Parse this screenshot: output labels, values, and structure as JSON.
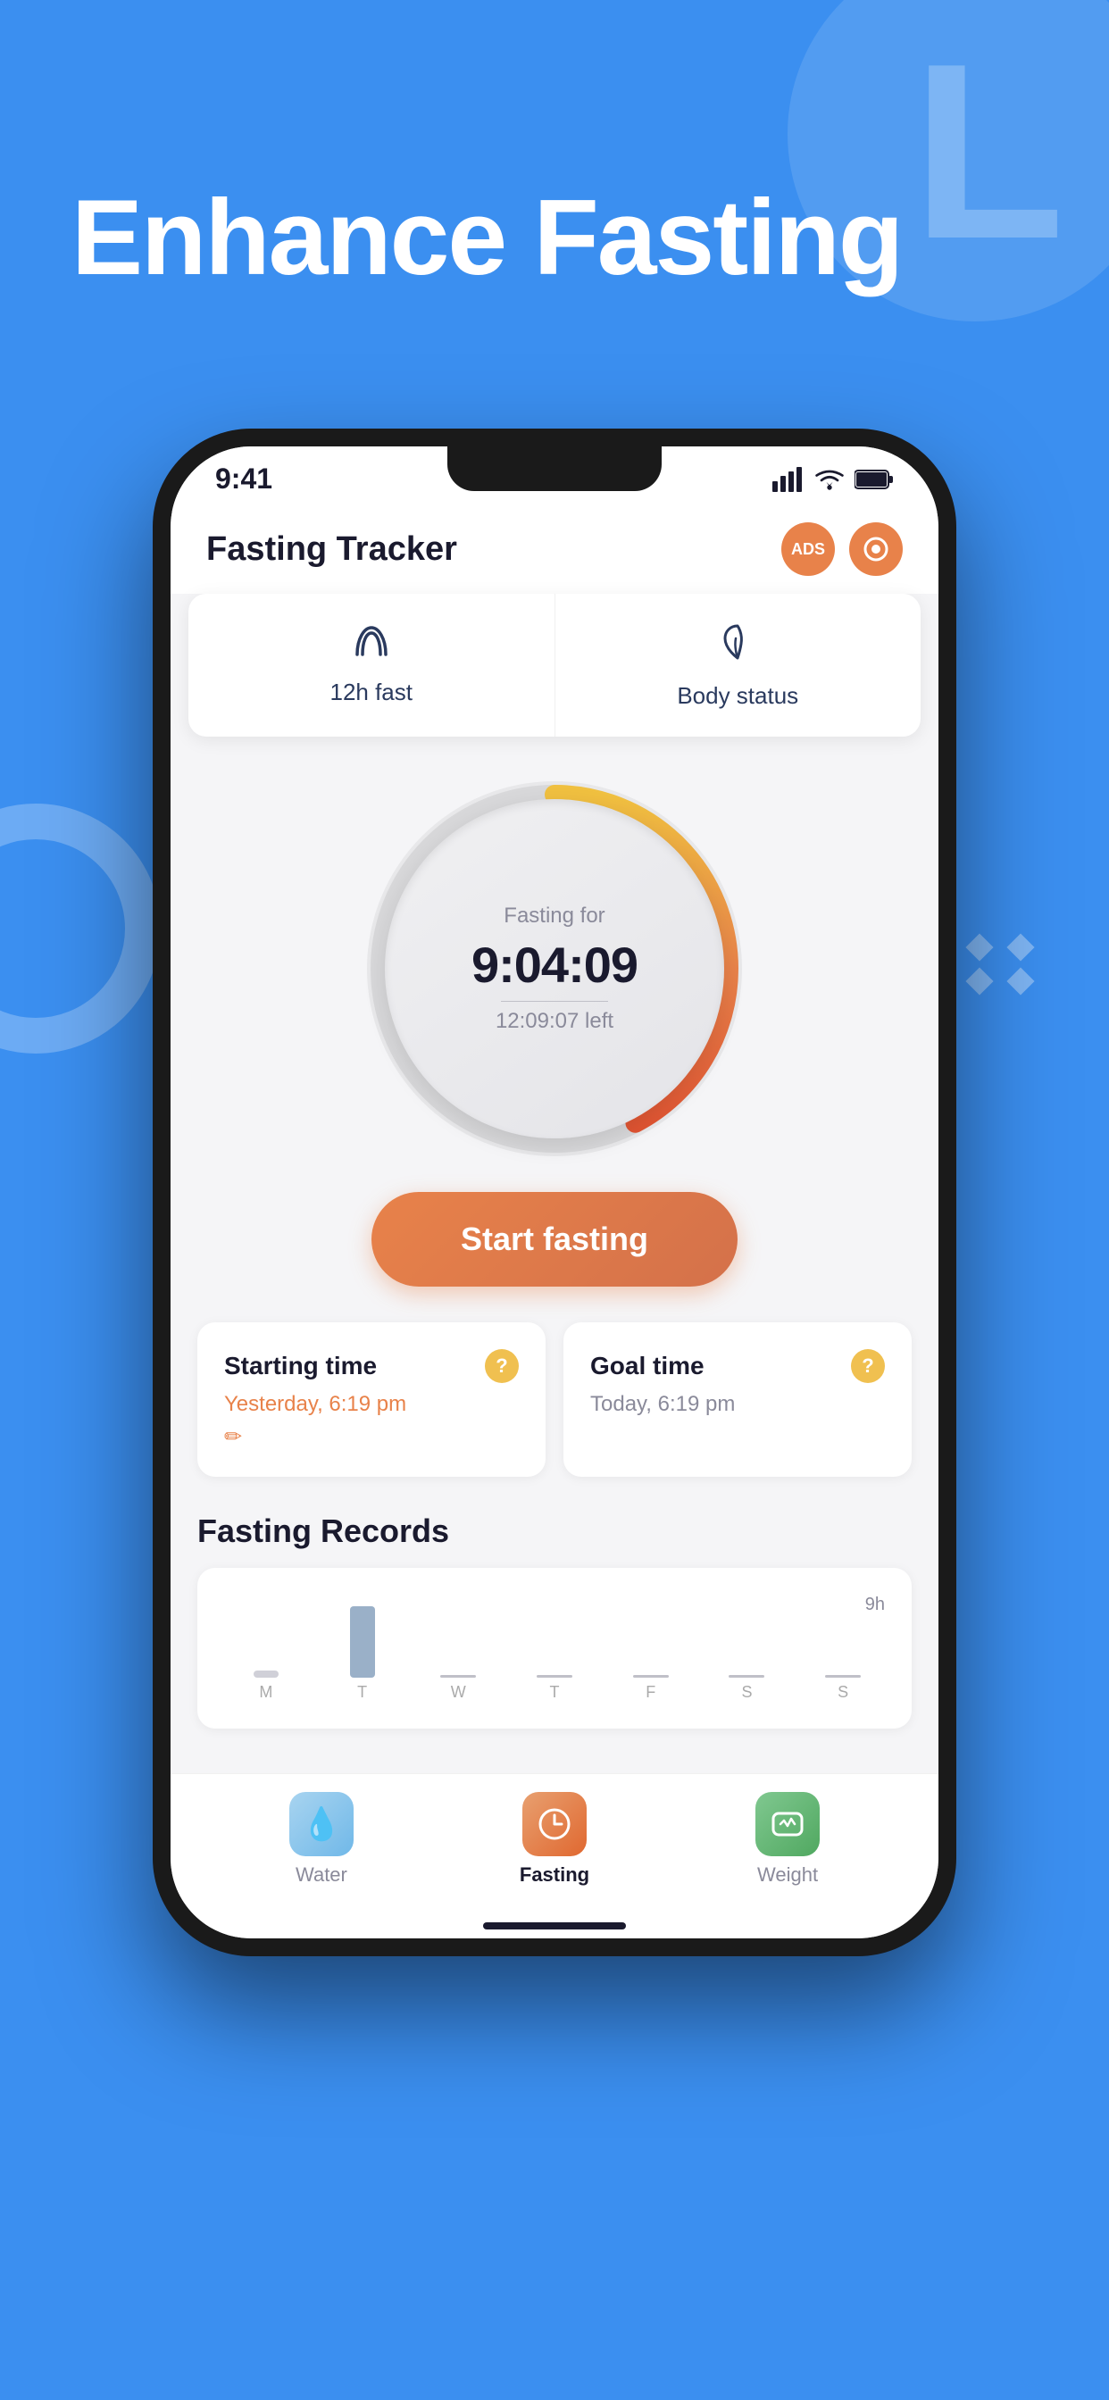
{
  "page": {
    "bg_color": "#3b8ff0",
    "title": "Enhance Fasting",
    "decorative_letter": "L"
  },
  "status_bar": {
    "time": "9:41",
    "signal_icon": "signal",
    "wifi_icon": "wifi",
    "battery_icon": "battery"
  },
  "app_header": {
    "title": "Fasting Tracker",
    "ads_label": "ADS",
    "record_label": "○"
  },
  "quick_tabs": [
    {
      "icon": "⌁",
      "label": "12h fast"
    },
    {
      "icon": "🍃",
      "label": "Body status"
    }
  ],
  "timer": {
    "label": "Fasting for",
    "display": "9:04:09",
    "remaining": "12:09:07 left",
    "progress_pct": 43
  },
  "start_button": {
    "label": "Start fasting"
  },
  "time_cards": [
    {
      "title": "Starting time",
      "help": "?",
      "value": "Yesterday, 6:19 pm",
      "has_edit": true
    },
    {
      "title": "Goal time",
      "help": "?",
      "value": "Today, 6:19 pm",
      "has_edit": false
    }
  ],
  "records_section": {
    "title": "Fasting Records",
    "chart_top_label": "9h",
    "days": [
      "M",
      "T",
      "W",
      "T",
      "F",
      "S",
      "S"
    ],
    "bar_heights": [
      0,
      80,
      0,
      0,
      0,
      0,
      0
    ],
    "active_day": 1
  },
  "bottom_nav": [
    {
      "icon": "💧",
      "label": "Water",
      "active": false,
      "icon_class": "nav-icon-water"
    },
    {
      "icon": "⏱",
      "label": "Fasting",
      "active": true,
      "icon_class": "nav-icon-fasting"
    },
    {
      "icon": "💬",
      "label": "Weight",
      "active": false,
      "icon_class": "nav-icon-weight"
    }
  ]
}
